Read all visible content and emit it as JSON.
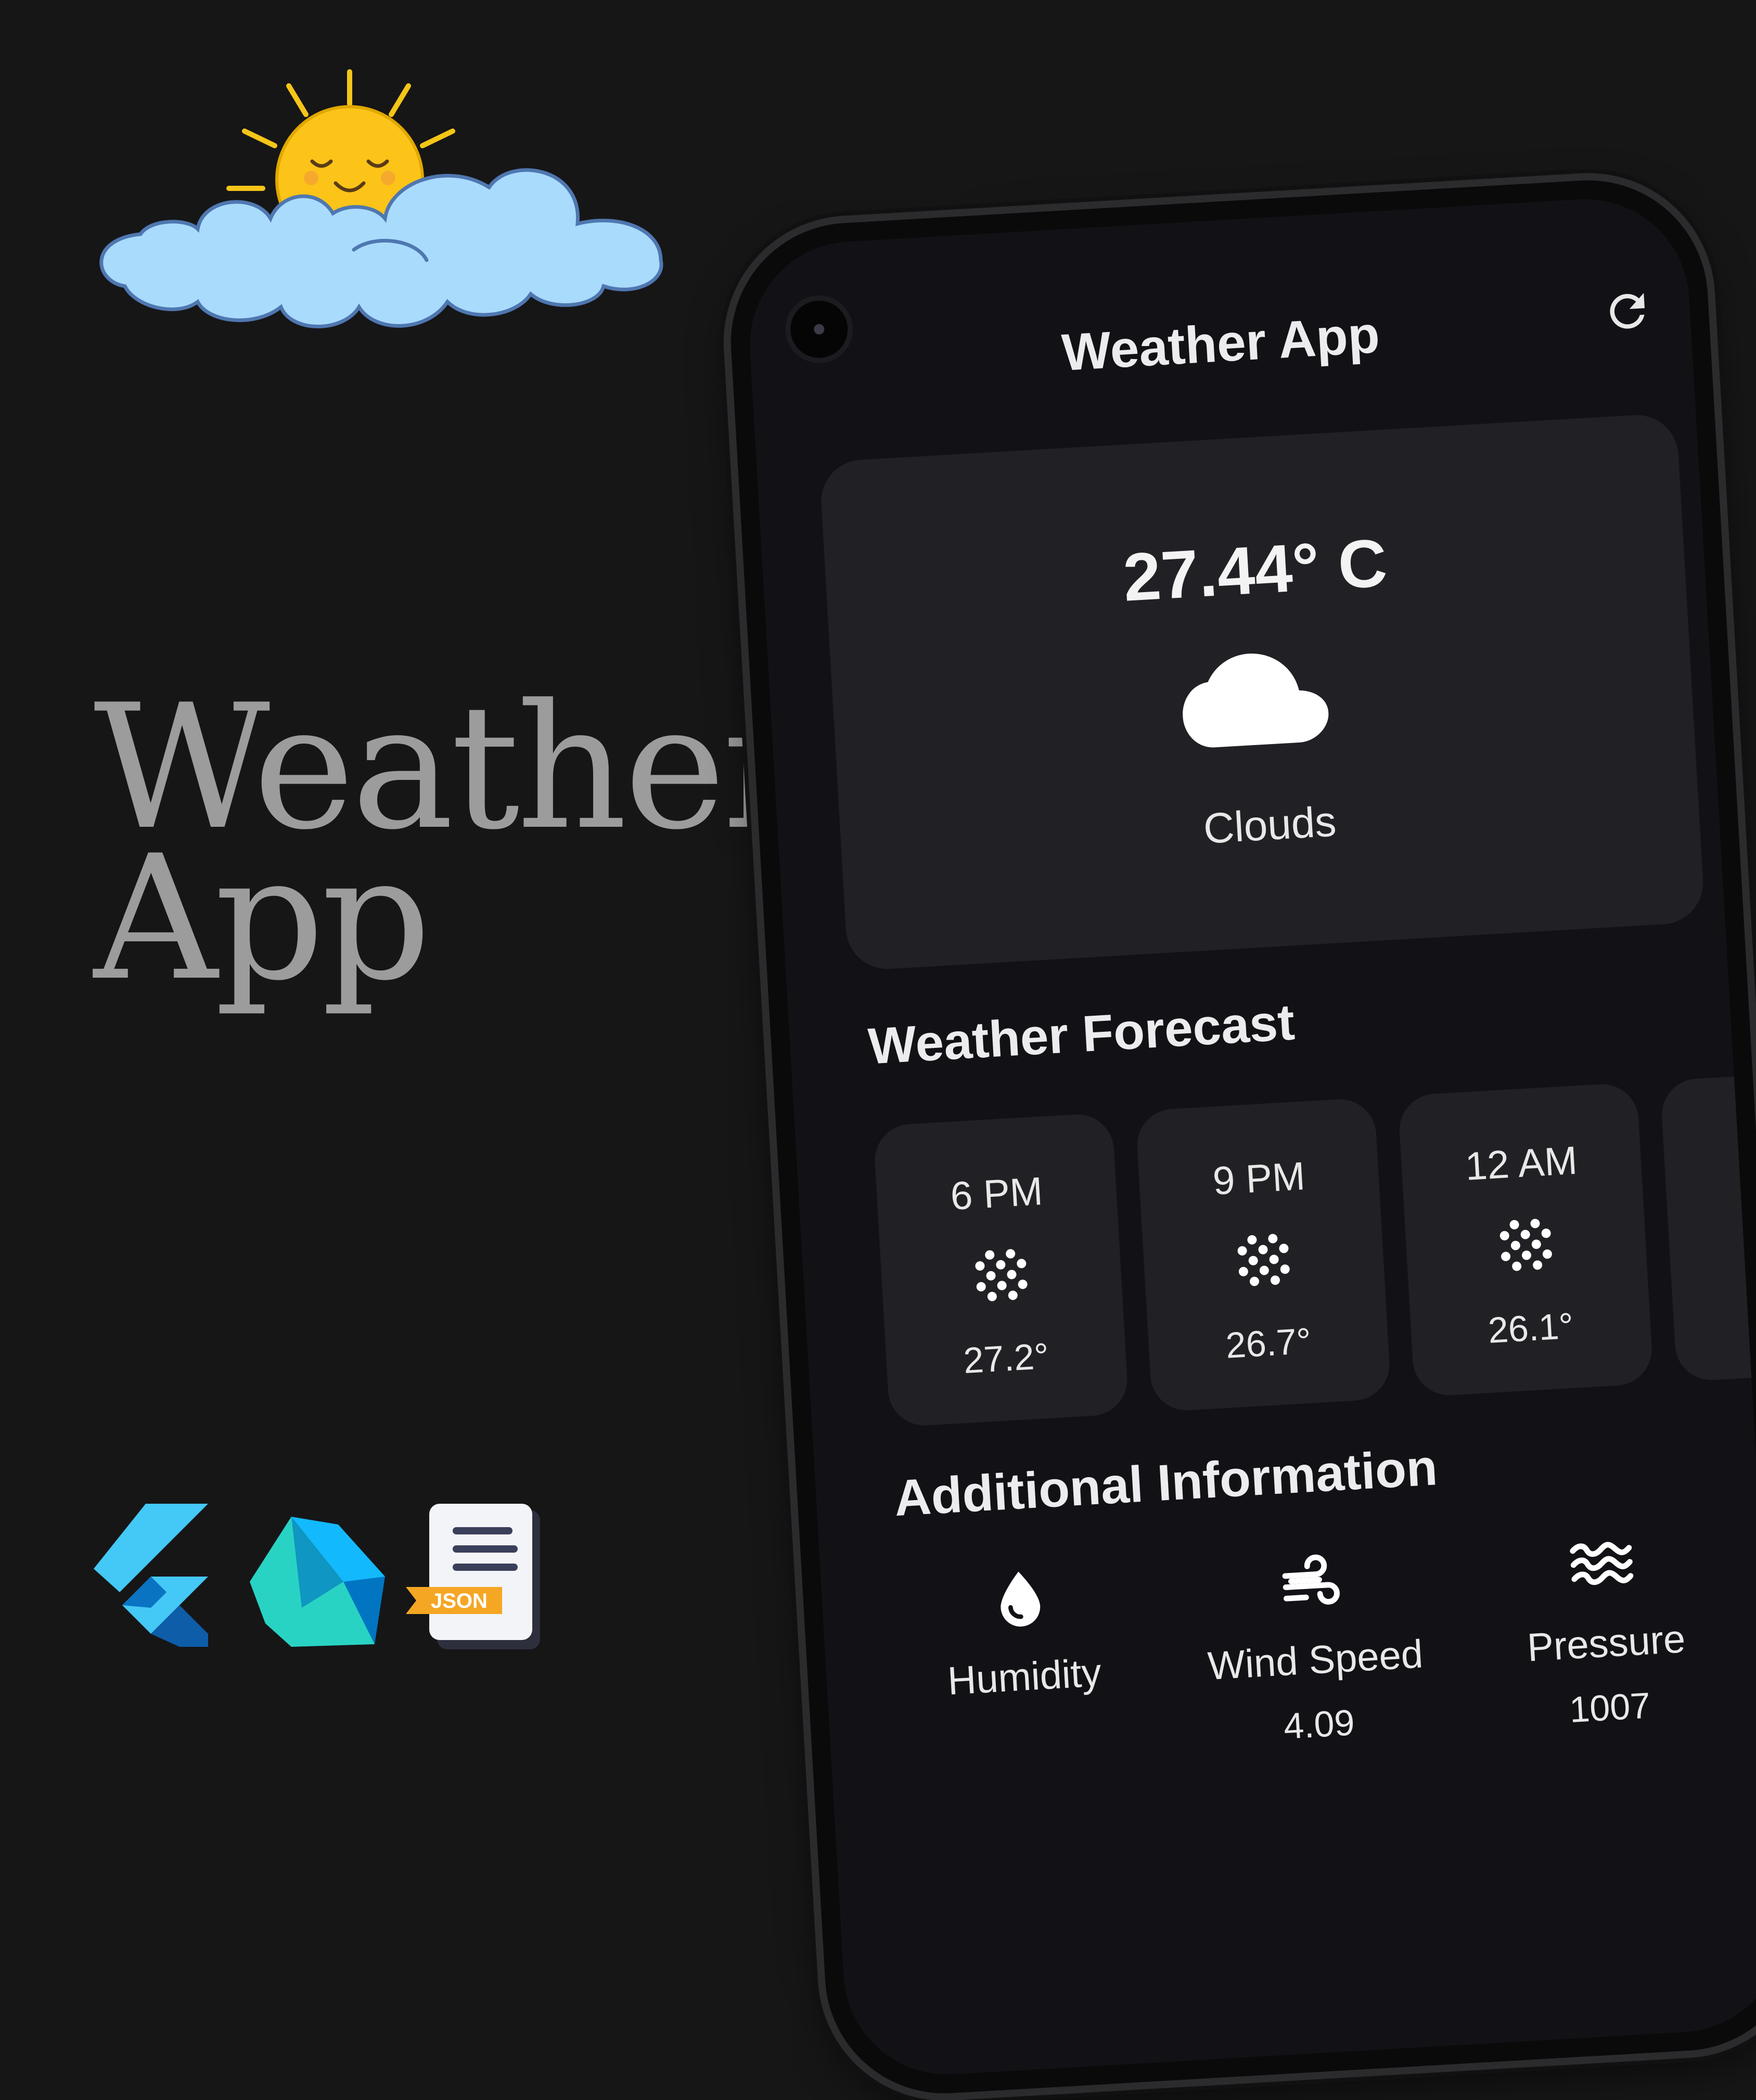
{
  "promo": {
    "title_line1": "Weather",
    "title_line2": "App",
    "json_badge": "JSON"
  },
  "app": {
    "title": "Weather App",
    "refresh_icon": "refresh-icon"
  },
  "current": {
    "temperature": "27.44° C",
    "condition": "Clouds",
    "icon": "cloud-icon"
  },
  "forecast": {
    "title": "Weather Forecast",
    "items": [
      {
        "time": "6 PM",
        "temp": "27.2°",
        "icon": "snow-icon"
      },
      {
        "time": "9 PM",
        "temp": "26.7°",
        "icon": "snow-icon"
      },
      {
        "time": "12 AM",
        "temp": "26.1°",
        "icon": "snow-icon"
      }
    ]
  },
  "additional": {
    "title": "Additional Information",
    "items": [
      {
        "label": "Humidity",
        "value": "",
        "icon": "water-drop-icon"
      },
      {
        "label": "Wind Speed",
        "value": "4.09",
        "icon": "wind-icon"
      },
      {
        "label": "Pressure",
        "value": "1007",
        "icon": "waves-icon"
      }
    ]
  },
  "colors": {
    "background": "#161617",
    "screen": "#121216",
    "card": "#212125",
    "text": "#ececee",
    "promo_text": "#9c9c9c",
    "sun": "#fcc419",
    "cloud": "#a9dbfd"
  }
}
